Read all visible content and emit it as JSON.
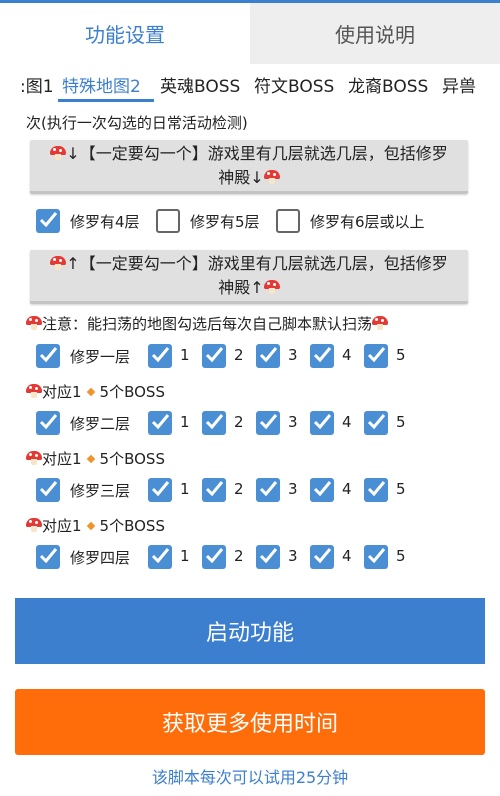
{
  "top_tabs": [
    {
      "label": "功能设置",
      "active": true
    },
    {
      "label": "使用说明",
      "active": false
    }
  ],
  "sub_tabs": [
    {
      "label": ":图1"
    },
    {
      "label": "特殊地图2",
      "active": true
    },
    {
      "label": "英魂BOSS"
    },
    {
      "label": "符文BOSS"
    },
    {
      "label": "龙裔BOSS"
    },
    {
      "label": "异兽"
    }
  ],
  "intro_text": "次(执行一次勾选的日常活动检测)",
  "banner_down": "↓【一定要勾一个】游戏里有几层就选几层，包括修罗神殿↓",
  "floor_options": [
    {
      "label": "修罗有4层",
      "checked": true
    },
    {
      "label": "修罗有5层",
      "checked": false
    },
    {
      "label": "修罗有6层或以上",
      "checked": false
    }
  ],
  "banner_up": "↑【一定要勾一个】游戏里有几层就选几层，包括修罗神殿↑",
  "notice": "注意：能扫荡的地图勾选后每次自己脚本默认扫荡",
  "floors": [
    {
      "name": "修罗一层",
      "checked": true,
      "bosses": [
        {
          "label": "1",
          "checked": true
        },
        {
          "label": "2",
          "checked": true
        },
        {
          "label": "3",
          "checked": true
        },
        {
          "label": "4",
          "checked": true
        },
        {
          "label": "5",
          "checked": true
        }
      ]
    },
    {
      "name": "修罗二层",
      "checked": true,
      "bosses": [
        {
          "label": "1",
          "checked": true
        },
        {
          "label": "2",
          "checked": true
        },
        {
          "label": "3",
          "checked": true
        },
        {
          "label": "4",
          "checked": true
        },
        {
          "label": "5",
          "checked": true
        }
      ]
    },
    {
      "name": "修罗三层",
      "checked": true,
      "bosses": [
        {
          "label": "1",
          "checked": true
        },
        {
          "label": "2",
          "checked": true
        },
        {
          "label": "3",
          "checked": true
        },
        {
          "label": "4",
          "checked": true
        },
        {
          "label": "5",
          "checked": true
        }
      ]
    },
    {
      "name": "修罗四层",
      "checked": true,
      "bosses": [
        {
          "label": "1",
          "checked": true
        },
        {
          "label": "2",
          "checked": true
        },
        {
          "label": "3",
          "checked": true
        },
        {
          "label": "4",
          "checked": true
        },
        {
          "label": "5",
          "checked": true
        }
      ]
    }
  ],
  "mapping_label": {
    "prefix": "对应1",
    "suffix": "5个BOSS"
  },
  "start_button": "启动功能",
  "more_time_button": "获取更多使用时间",
  "trial_note": "该脚本每次可以试用25分钟",
  "colors": {
    "accent": "#3d7fcf",
    "orange": "#ff6d0a",
    "checkbox": "#4a8ed4"
  }
}
